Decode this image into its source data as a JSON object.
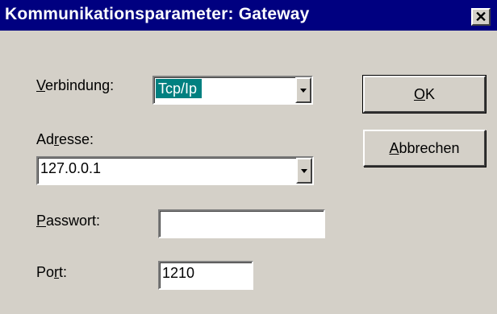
{
  "window": {
    "title": "Kommunikationsparameter: Gateway",
    "close_glyph": "✕"
  },
  "form": {
    "connection": {
      "label_mnemonic": "V",
      "label_rest": "erbindung:",
      "value": "Tcp/Ip"
    },
    "address": {
      "label_pre": "Ad",
      "label_mnemonic": "r",
      "label_post": "esse:",
      "value": "127.0.0.1"
    },
    "password": {
      "label_mnemonic": "P",
      "label_rest": "asswort:",
      "value": ""
    },
    "port": {
      "label_pre": "Po",
      "label_mnemonic": "r",
      "label_post": "t:",
      "value": "1210"
    }
  },
  "buttons": {
    "ok": {
      "mnemonic": "O",
      "rest": "K"
    },
    "cancel": {
      "mnemonic": "A",
      "rest": "bbrechen"
    }
  },
  "icons": {
    "dropdown": "chevron-down-icon",
    "close": "close-icon"
  },
  "colors": {
    "titlebar": "#000080",
    "selection": "#008080",
    "dialog": "#d4d0c8"
  }
}
